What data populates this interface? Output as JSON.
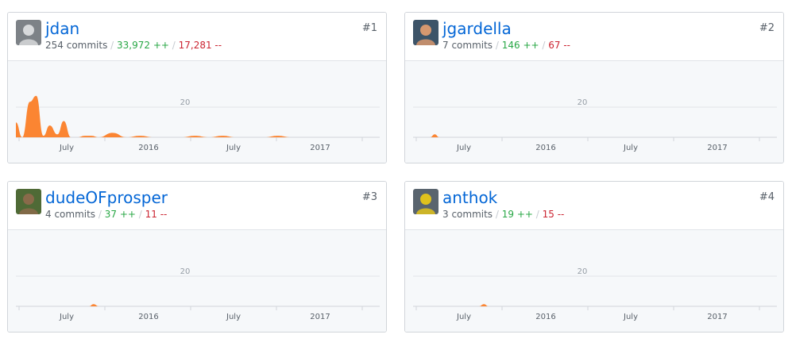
{
  "contributors": [
    {
      "login": "jdan",
      "rank": "#1",
      "commits": "254 commits",
      "additions": "33,972 ++",
      "deletions": "17,281 --",
      "avatar": {
        "bg": "#7d8287",
        "fg": "#d7d9db"
      }
    },
    {
      "login": "jgardella",
      "rank": "#2",
      "commits": "7 commits",
      "additions": "146 ++",
      "deletions": "67 --",
      "avatar": {
        "bg": "#3d5468",
        "fg": "#d7986f"
      }
    },
    {
      "login": "dudeOFprosper",
      "rank": "#3",
      "commits": "4 commits",
      "additions": "37 ++",
      "deletions": "11 --",
      "avatar": {
        "bg": "#4f6a36",
        "fg": "#8a6a4a"
      }
    },
    {
      "login": "anthok",
      "rank": "#4",
      "commits": "3 commits",
      "additions": "19 ++",
      "deletions": "15 --",
      "avatar": {
        "bg": "#59646e",
        "fg": "#e0c21c"
      }
    }
  ],
  "chart_data": [
    {
      "type": "area",
      "x": [
        "2015-03-01",
        "2015-03-15",
        "2015-04-01",
        "2015-04-15",
        "2015-05-01",
        "2015-05-15",
        "2015-06-01",
        "2015-06-15",
        "2015-07-01",
        "2015-07-15",
        "2015-08-01",
        "2015-08-15",
        "2015-09-01",
        "2015-10-01",
        "2015-11-01",
        "2015-12-01",
        "2016-01-01",
        "2016-03-01",
        "2016-04-01",
        "2016-05-01",
        "2016-06-01",
        "2016-07-01",
        "2016-08-01",
        "2016-09-01",
        "2016-10-01",
        "2016-11-01",
        "2016-12-01",
        "2017-01-01",
        "2017-02-01",
        "2017-03-01",
        "2017-04-01",
        "2017-05-01"
      ],
      "values": [
        10,
        0,
        24,
        28,
        1,
        8,
        2,
        11,
        0,
        0,
        1,
        1,
        0,
        3,
        0,
        1,
        0,
        0,
        1,
        0,
        1,
        0,
        0,
        0,
        1,
        0,
        0,
        0,
        0,
        0,
        0,
        0
      ],
      "reference_line": 20,
      "reference_label": "20",
      "xticks": [
        "July",
        "2016",
        "July",
        "2017"
      ],
      "color": "#fb8532",
      "ylim": [
        0,
        30
      ]
    },
    {
      "type": "area",
      "x": [
        "2015-03-01",
        "2015-04-01",
        "2015-05-01",
        "2015-06-01",
        "2015-07-01",
        "2015-08-01",
        "2015-09-01",
        "2015-10-01",
        "2015-11-01",
        "2015-12-01",
        "2016-01-01",
        "2016-03-01",
        "2016-05-01",
        "2016-07-01",
        "2016-09-01",
        "2016-11-01",
        "2017-01-01",
        "2017-03-01",
        "2017-05-01"
      ],
      "values": [
        0,
        0,
        0,
        0,
        0,
        0,
        0,
        0,
        0,
        0,
        0,
        0,
        0,
        0,
        0,
        0,
        0,
        0,
        0
      ],
      "extra_points": [
        {
          "date": "2015-04-08",
          "value": 0
        },
        {
          "date": "2015-04-18",
          "value": 2
        },
        {
          "date": "2015-04-28",
          "value": 0
        }
      ],
      "reference_line": 20,
      "reference_label": "20",
      "xticks": [
        "July",
        "2016",
        "July",
        "2017"
      ],
      "color": "#fb8532",
      "ylim": [
        0,
        30
      ]
    },
    {
      "type": "area",
      "x": [
        "2015-03-01",
        "2015-05-01",
        "2015-09-01",
        "2016-01-01",
        "2016-05-01",
        "2016-09-01",
        "2017-01-01",
        "2017-05-01"
      ],
      "values": [
        0,
        0,
        0,
        0,
        0,
        0,
        0,
        0
      ],
      "extra_points": [
        {
          "date": "2015-08-10",
          "value": 0
        },
        {
          "date": "2015-08-20",
          "value": 1.5
        },
        {
          "date": "2015-09-05",
          "value": 0
        }
      ],
      "reference_line": 20,
      "reference_label": "20",
      "xticks": [
        "July",
        "2016",
        "July",
        "2017"
      ],
      "color": "#fb8532",
      "ylim": [
        0,
        30
      ]
    },
    {
      "type": "area",
      "x": [
        "2015-03-01",
        "2015-05-01",
        "2015-09-01",
        "2016-01-01",
        "2016-05-01",
        "2016-09-01",
        "2017-01-01",
        "2017-05-01"
      ],
      "values": [
        0,
        0,
        0,
        0,
        0,
        0,
        0,
        0
      ],
      "extra_points": [
        {
          "date": "2015-07-25",
          "value": 0
        },
        {
          "date": "2015-08-05",
          "value": 1.5
        },
        {
          "date": "2015-08-15",
          "value": 0
        }
      ],
      "reference_line": 20,
      "reference_label": "20",
      "xticks": [
        "July",
        "2016",
        "July",
        "2017"
      ],
      "color": "#fb8532",
      "ylim": [
        0,
        30
      ]
    }
  ]
}
